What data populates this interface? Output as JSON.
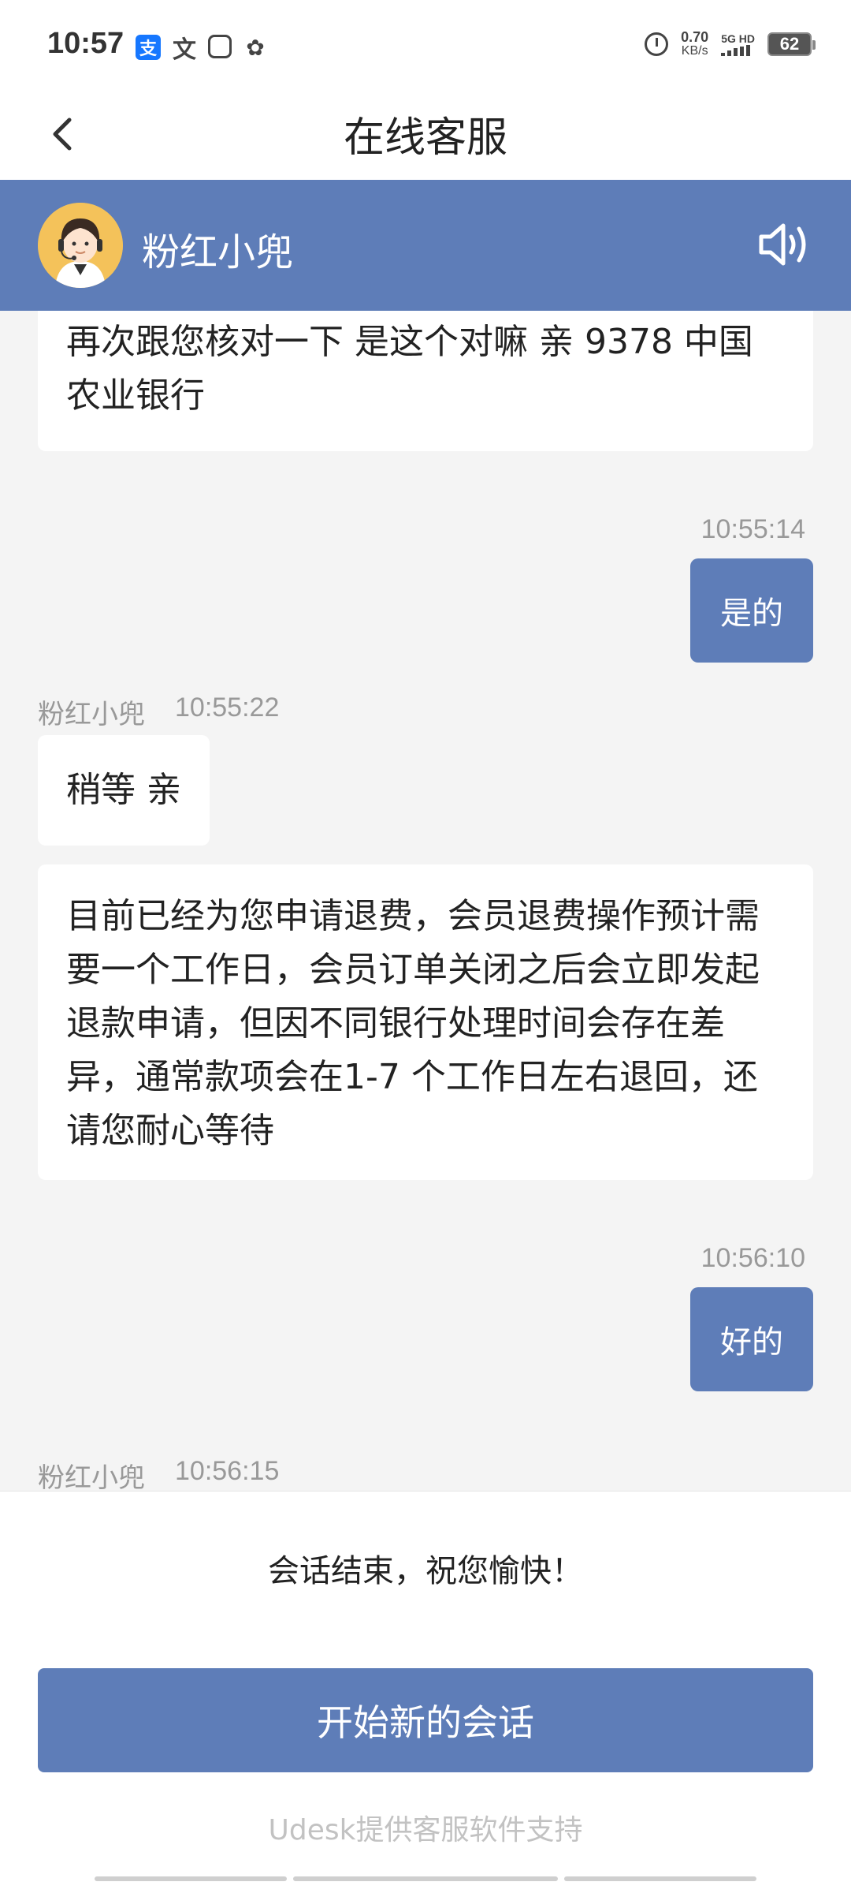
{
  "status_bar": {
    "time": "10:57",
    "app_icons": [
      {
        "name": "alipay-icon",
        "glyph": "支"
      },
      {
        "name": "translate-icon",
        "glyph": "文"
      },
      {
        "name": "app-icon",
        "glyph": ""
      },
      {
        "name": "wechat-icon",
        "glyph": "✿"
      }
    ],
    "net_speed_value": "0.70",
    "net_speed_unit": "KB/s",
    "signal_label": "5G HD",
    "battery": "62"
  },
  "header": {
    "title": "在线客服"
  },
  "agent": {
    "name": "粉红小兜"
  },
  "messages": {
    "m1_text": "再次跟您核对一下 是这个对嘛 亲 9378 中国农业银行",
    "m2_time": "10:55:14",
    "m2_text": "是的",
    "m3_sender": "粉红小兜",
    "m3_time": "10:55:22",
    "m3_text": "稍等 亲",
    "m4_text": "目前已经为您申请退费，会员退费操作预计需要一个工作日，会员订单关闭之后会立即发起退款申请，但因不同银行处理时间会存在差异，通常款项会在1-7 个工作日左右退回，还请您耐心等待",
    "m5_time": "10:56:10",
    "m5_text": "好的",
    "m6_sender": "粉红小兜",
    "m6_time": "10:56:15"
  },
  "footer": {
    "end_message": "会话结束，祝您愉快！",
    "new_chat_label": "开始新的会话",
    "powered_by": "Udesk提供客服软件支持"
  },
  "colors": {
    "brand": "#5e7db8",
    "background": "#f4f4f4",
    "bubble_left": "#ffffff",
    "muted_text": "#999999"
  }
}
